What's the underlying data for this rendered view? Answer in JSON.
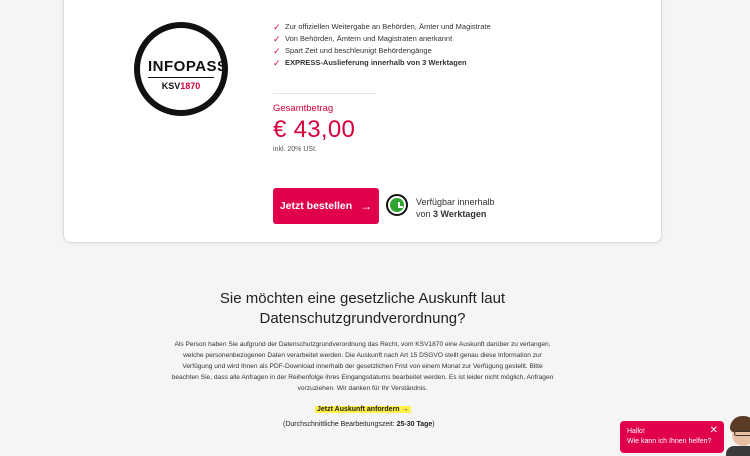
{
  "product": {
    "badge_title": "INFOPASS",
    "badge_sub_prefix": "KSV",
    "badge_sub_accent": "1870",
    "features": [
      "Zur offiziellen Weitergabe an Behörden, Ämter und Magistrate",
      "Von Behörden, Ämtern und Magistraten anerkannt",
      "Spart Zeit und beschleunigt Behördengänge",
      "EXPRESS-Auslieferung innerhalb von 3 Werktagen"
    ],
    "total_label": "Gesamtbetrag",
    "price": "€ 43,00",
    "vat_note": "inkl. 20% USt.",
    "order_button": "Jetzt bestellen",
    "availability_line1": "Verfügbar innerhalb",
    "availability_prefix": "von",
    "availability_bold": "3 Werktagen"
  },
  "gdpr": {
    "heading": "Sie möchten eine gesetzliche Auskunft laut Datenschutzgrundverordnung?",
    "body": "Als Person haben Sie aufgrund der Datenschutzgrundverordnung das Recht, vom KSV1870 eine Auskunft darüber zu verlangen, welche personenbezogenen Daten verarbeitet werden. Die Auskunft nach Art 15 DSGVO stellt genau diese Information zur Verfügung und wird Ihnen als PDF-Download innerhalb der gesetzlichen Frist von einem Monat zur Verfügung gestellt. Bitte beachten Sie, dass alle Anfragen in der Reihenfolge ihres Eingangsdatums bearbeitet werden. Es ist leider nicht möglich, Anfragen vorzuziehen. Wir danken für Ihr Verständnis.",
    "cta": "Jetzt Auskunft anfordern",
    "duration_label": "(Durchschnittliche Bearbeitungszeit:",
    "duration_value": "25-30 Tage",
    "duration_end": ")"
  },
  "chat": {
    "line1": "Hallo!",
    "line2": "Wie kann ich Ihnen helfen?"
  },
  "colors": {
    "accent": "#e0004d",
    "highlight": "#fff04a",
    "clock_green": "#2ea52e"
  },
  "icons": [
    "check-icon",
    "arrow-right-icon",
    "clock-icon",
    "close-icon"
  ]
}
